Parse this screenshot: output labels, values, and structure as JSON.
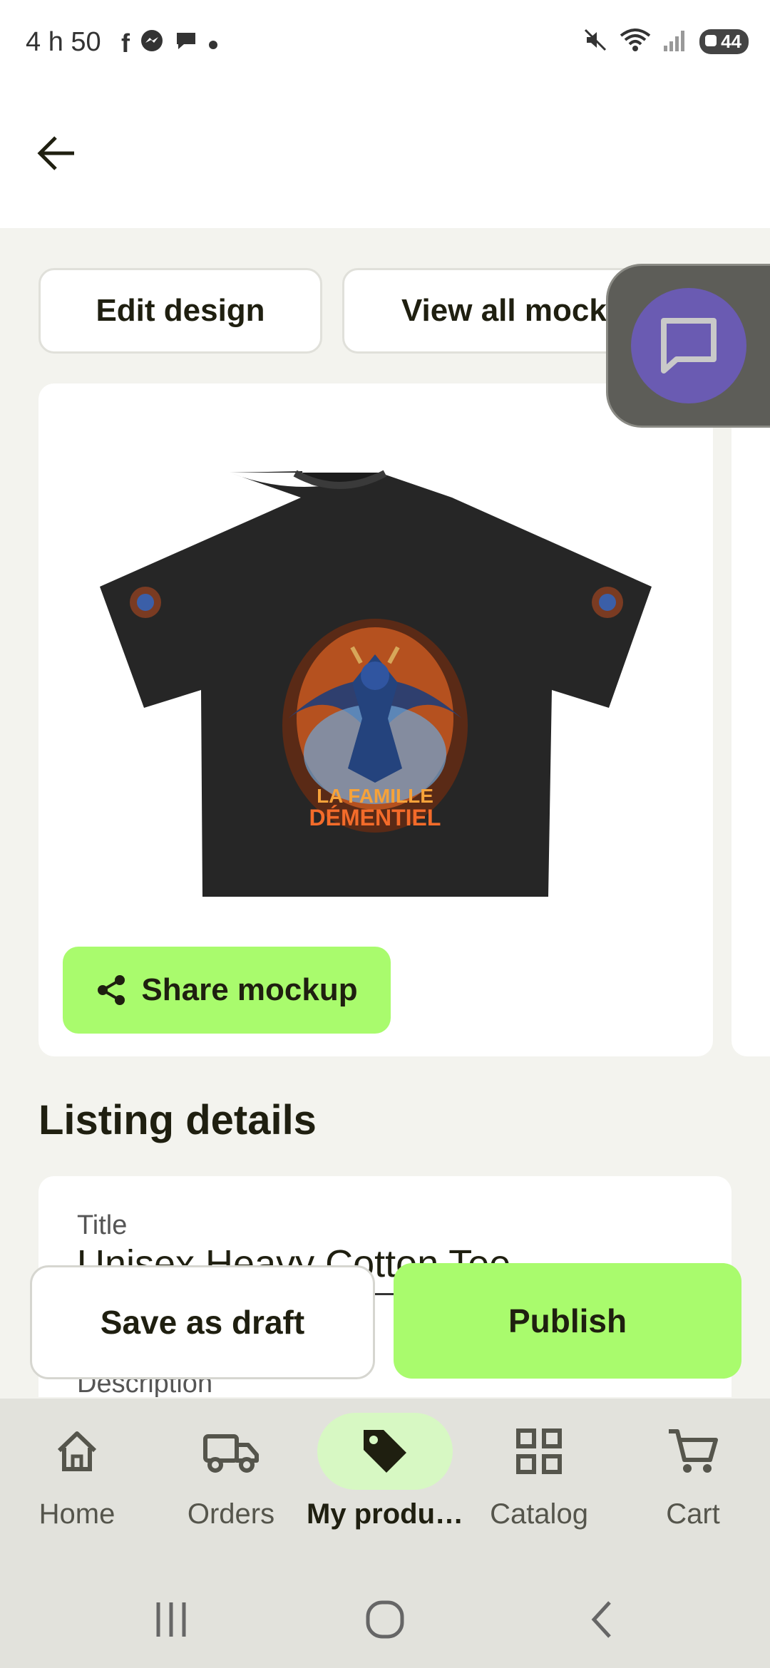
{
  "status_bar": {
    "time": "4 h 50",
    "battery": "44",
    "left_icons": [
      "facebook-icon",
      "messenger-icon",
      "chat-icon",
      "dot-icon"
    ],
    "right_icons": [
      "mute-icon",
      "wifi-icon",
      "signal-icon",
      "battery-icon"
    ]
  },
  "header": {
    "back_icon": "arrow-left-icon"
  },
  "actions": {
    "edit_design": "Edit design",
    "view_all_mockups": "View all mockups"
  },
  "mockup": {
    "image_desc": "black t-shirt with demon graphic",
    "print_line1": "LA FAMILLE",
    "print_line2": "DÉMENTIEL",
    "share_label": "Share mockup"
  },
  "listing": {
    "section_title": "Listing details",
    "title_label": "Title",
    "title_value": "Unisex Heavy Cotton Tee",
    "description_label": "Description"
  },
  "footer_actions": {
    "save_draft": "Save as draft",
    "publish": "Publish"
  },
  "bottom_nav": {
    "items": [
      {
        "label": "Home",
        "icon": "home-icon"
      },
      {
        "label": "Orders",
        "icon": "truck-icon"
      },
      {
        "label": "My produ…",
        "icon": "tag-icon"
      },
      {
        "label": "Catalog",
        "icon": "grid-icon"
      },
      {
        "label": "Cart",
        "icon": "cart-icon"
      }
    ],
    "active_index": 2
  },
  "colors": {
    "accent_green": "#a9fb6d",
    "chat_purple": "#6a5bb2",
    "background": "#f3f3ee",
    "text_dark": "#1f1f10"
  }
}
